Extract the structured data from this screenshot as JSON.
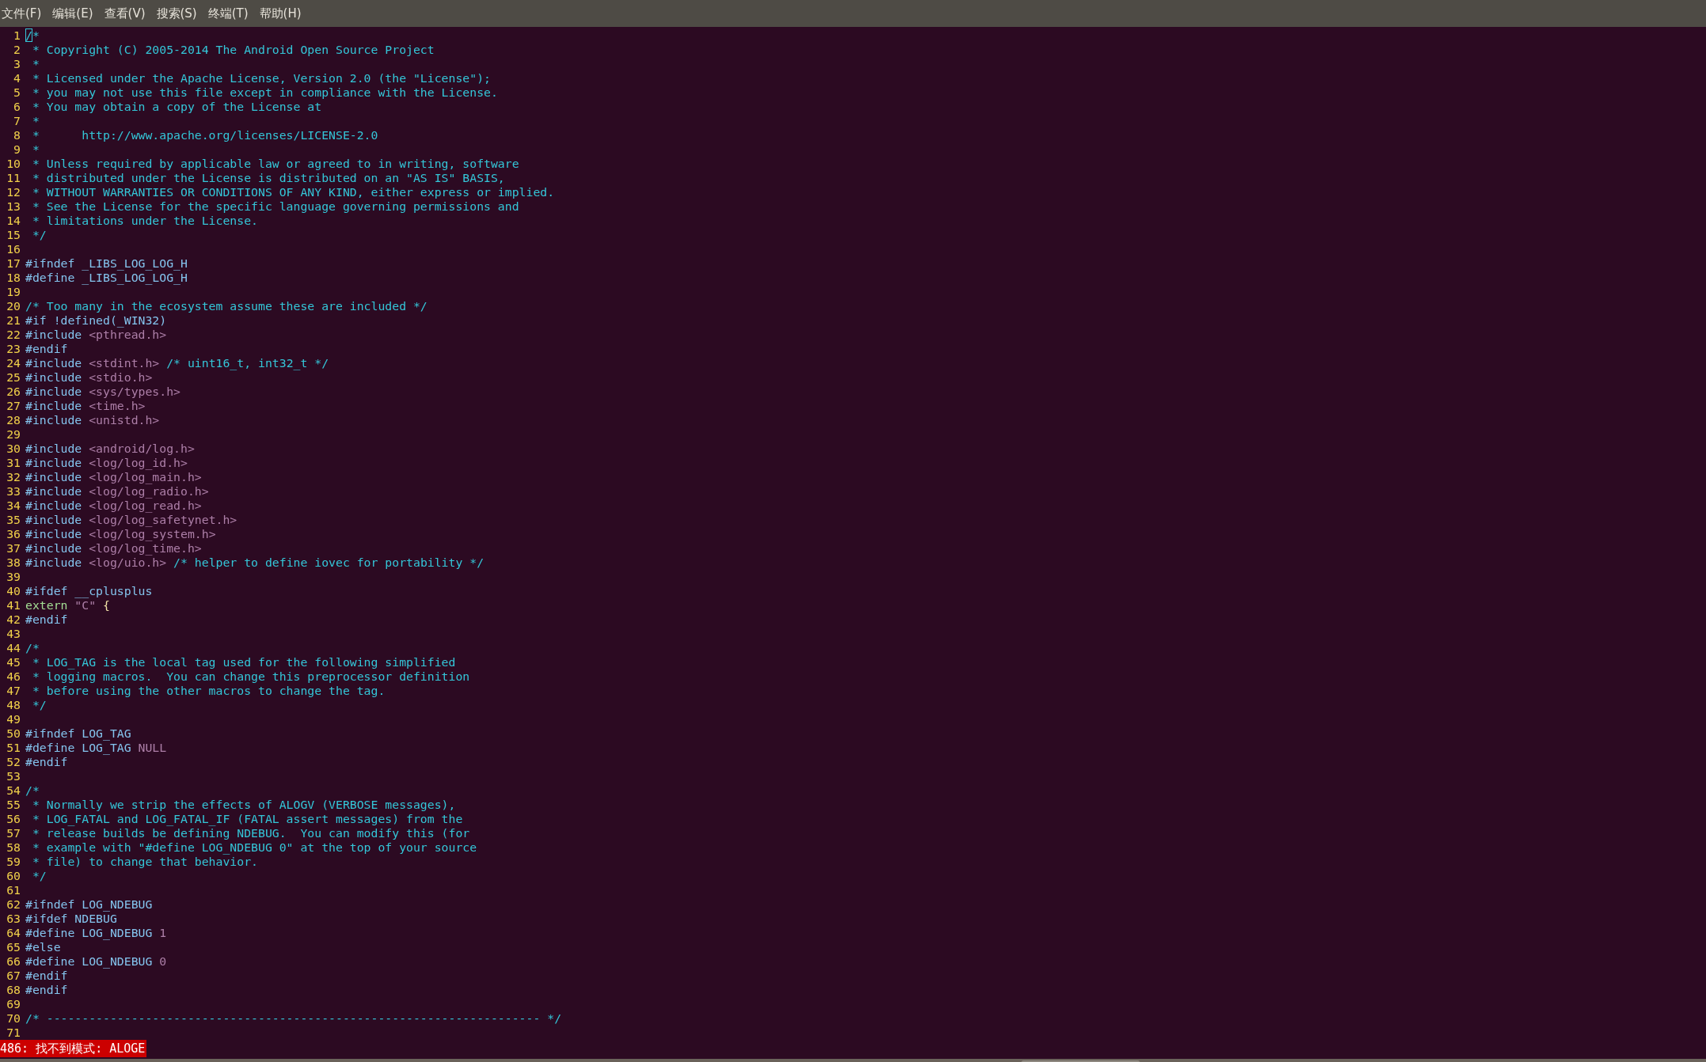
{
  "menu_bar": {
    "items": [
      {
        "label": "文件(F)"
      },
      {
        "label": "编辑(E)"
      },
      {
        "label": "查看(V)"
      },
      {
        "label": "搜索(S)"
      },
      {
        "label": "终端(T)"
      },
      {
        "label": "帮助(H)"
      }
    ]
  },
  "editor": {
    "lines": [
      {
        "number": "1",
        "segments": [
          {
            "kind": "cursor",
            "text": "/"
          },
          {
            "kind": "comment",
            "text": "*"
          }
        ]
      },
      {
        "number": "2",
        "segments": [
          {
            "kind": "comment",
            "text": " * Copyright (C) 2005-2014 The Android Open Source Project"
          }
        ]
      },
      {
        "number": "3",
        "segments": [
          {
            "kind": "comment",
            "text": " *"
          }
        ]
      },
      {
        "number": "4",
        "segments": [
          {
            "kind": "comment",
            "text": " * Licensed under the Apache License, Version 2.0 (the \"License\");"
          }
        ]
      },
      {
        "number": "5",
        "segments": [
          {
            "kind": "comment",
            "text": " * you may not use this file except in compliance with the License."
          }
        ]
      },
      {
        "number": "6",
        "segments": [
          {
            "kind": "comment",
            "text": " * You may obtain a copy of the License at"
          }
        ]
      },
      {
        "number": "7",
        "segments": [
          {
            "kind": "comment",
            "text": " *"
          }
        ]
      },
      {
        "number": "8",
        "segments": [
          {
            "kind": "comment",
            "text": " *      http://www.apache.org/licenses/LICENSE-2.0"
          }
        ]
      },
      {
        "number": "9",
        "segments": [
          {
            "kind": "comment",
            "text": " *"
          }
        ]
      },
      {
        "number": "10",
        "segments": [
          {
            "kind": "comment",
            "text": " * Unless required by applicable law or agreed to in writing, software"
          }
        ]
      },
      {
        "number": "11",
        "segments": [
          {
            "kind": "comment",
            "text": " * distributed under the License is distributed on an \"AS IS\" BASIS,"
          }
        ]
      },
      {
        "number": "12",
        "segments": [
          {
            "kind": "comment",
            "text": " * WITHOUT WARRANTIES OR CONDITIONS OF ANY KIND, either express or implied."
          }
        ]
      },
      {
        "number": "13",
        "segments": [
          {
            "kind": "comment",
            "text": " * See the License for the specific language governing permissions and"
          }
        ]
      },
      {
        "number": "14",
        "segments": [
          {
            "kind": "comment",
            "text": " * limitations under the License."
          }
        ]
      },
      {
        "number": "15",
        "segments": [
          {
            "kind": "comment",
            "text": " */"
          }
        ]
      },
      {
        "number": "16"
      },
      {
        "number": "17",
        "segments": [
          {
            "kind": "preproc",
            "text": "#ifndef _LIBS_LOG_LOG_H"
          }
        ]
      },
      {
        "number": "18",
        "segments": [
          {
            "kind": "preproc",
            "text": "#define _LIBS_LOG_LOG_H"
          }
        ]
      },
      {
        "number": "19"
      },
      {
        "number": "20",
        "segments": [
          {
            "kind": "comment",
            "text": "/* Too many in the ecosystem assume these are included */"
          }
        ]
      },
      {
        "number": "21",
        "segments": [
          {
            "kind": "preproc",
            "text": "#if !defined(_WIN32)"
          }
        ]
      },
      {
        "number": "22",
        "segments": [
          {
            "kind": "preproc",
            "text": "#include "
          },
          {
            "kind": "constant",
            "text": "<pthread.h>"
          }
        ]
      },
      {
        "number": "23",
        "segments": [
          {
            "kind": "preproc",
            "text": "#endif"
          }
        ]
      },
      {
        "number": "24",
        "segments": [
          {
            "kind": "preproc",
            "text": "#include "
          },
          {
            "kind": "constant",
            "text": "<stdint.h>"
          },
          {
            "kind": "comment",
            "text": " /* uint16_t, int32_t */"
          }
        ]
      },
      {
        "number": "25",
        "segments": [
          {
            "kind": "preproc",
            "text": "#include "
          },
          {
            "kind": "constant",
            "text": "<stdio.h>"
          }
        ]
      },
      {
        "number": "26",
        "segments": [
          {
            "kind": "preproc",
            "text": "#include "
          },
          {
            "kind": "constant",
            "text": "<sys/types.h>"
          }
        ]
      },
      {
        "number": "27",
        "segments": [
          {
            "kind": "preproc",
            "text": "#include "
          },
          {
            "kind": "constant",
            "text": "<time.h>"
          }
        ]
      },
      {
        "number": "28",
        "segments": [
          {
            "kind": "preproc",
            "text": "#include "
          },
          {
            "kind": "constant",
            "text": "<unistd.h>"
          }
        ]
      },
      {
        "number": "29"
      },
      {
        "number": "30",
        "segments": [
          {
            "kind": "preproc",
            "text": "#include "
          },
          {
            "kind": "constant",
            "text": "<android/log.h>"
          }
        ]
      },
      {
        "number": "31",
        "segments": [
          {
            "kind": "preproc",
            "text": "#include "
          },
          {
            "kind": "constant",
            "text": "<log/log_id.h>"
          }
        ]
      },
      {
        "number": "32",
        "segments": [
          {
            "kind": "preproc",
            "text": "#include "
          },
          {
            "kind": "constant",
            "text": "<log/log_main.h>"
          }
        ]
      },
      {
        "number": "33",
        "segments": [
          {
            "kind": "preproc",
            "text": "#include "
          },
          {
            "kind": "constant",
            "text": "<log/log_radio.h>"
          }
        ]
      },
      {
        "number": "34",
        "segments": [
          {
            "kind": "preproc",
            "text": "#include "
          },
          {
            "kind": "constant",
            "text": "<log/log_read.h>"
          }
        ]
      },
      {
        "number": "35",
        "segments": [
          {
            "kind": "preproc",
            "text": "#include "
          },
          {
            "kind": "constant",
            "text": "<log/log_safetynet.h>"
          }
        ]
      },
      {
        "number": "36",
        "segments": [
          {
            "kind": "preproc",
            "text": "#include "
          },
          {
            "kind": "constant",
            "text": "<log/log_system.h>"
          }
        ]
      },
      {
        "number": "37",
        "segments": [
          {
            "kind": "preproc",
            "text": "#include "
          },
          {
            "kind": "constant",
            "text": "<log/log_time.h>"
          }
        ]
      },
      {
        "number": "38",
        "segments": [
          {
            "kind": "preproc",
            "text": "#include "
          },
          {
            "kind": "constant",
            "text": "<log/uio.h>"
          },
          {
            "kind": "comment",
            "text": " /* helper to define iovec for portability */"
          }
        ]
      },
      {
        "number": "39"
      },
      {
        "number": "40",
        "segments": [
          {
            "kind": "preproc",
            "text": "#ifdef __cplusplus"
          }
        ]
      },
      {
        "number": "41",
        "segments": [
          {
            "kind": "keyword",
            "text": "extern "
          },
          {
            "kind": "constant",
            "text": "\"C\""
          },
          {
            "kind": "plain",
            "text": " {"
          }
        ]
      },
      {
        "number": "42",
        "segments": [
          {
            "kind": "preproc",
            "text": "#endif"
          }
        ]
      },
      {
        "number": "43"
      },
      {
        "number": "44",
        "segments": [
          {
            "kind": "comment",
            "text": "/*"
          }
        ]
      },
      {
        "number": "45",
        "segments": [
          {
            "kind": "comment",
            "text": " * LOG_TAG is the local tag used for the following simplified"
          }
        ]
      },
      {
        "number": "46",
        "segments": [
          {
            "kind": "comment",
            "text": " * logging macros.  You can change this preprocessor definition"
          }
        ]
      },
      {
        "number": "47",
        "segments": [
          {
            "kind": "comment",
            "text": " * before using the other macros to change the tag."
          }
        ]
      },
      {
        "number": "48",
        "segments": [
          {
            "kind": "comment",
            "text": " */"
          }
        ]
      },
      {
        "number": "49"
      },
      {
        "number": "50",
        "segments": [
          {
            "kind": "preproc",
            "text": "#ifndef LOG_TAG"
          }
        ]
      },
      {
        "number": "51",
        "segments": [
          {
            "kind": "preproc",
            "text": "#define LOG_TAG "
          },
          {
            "kind": "constant",
            "text": "NULL"
          }
        ]
      },
      {
        "number": "52",
        "segments": [
          {
            "kind": "preproc",
            "text": "#endif"
          }
        ]
      },
      {
        "number": "53"
      },
      {
        "number": "54",
        "segments": [
          {
            "kind": "comment",
            "text": "/*"
          }
        ]
      },
      {
        "number": "55",
        "segments": [
          {
            "kind": "comment",
            "text": " * Normally we strip the effects of ALOGV (VERBOSE messages),"
          }
        ]
      },
      {
        "number": "56",
        "segments": [
          {
            "kind": "comment",
            "text": " * LOG_FATAL and LOG_FATAL_IF (FATAL assert messages) from the"
          }
        ]
      },
      {
        "number": "57",
        "segments": [
          {
            "kind": "comment",
            "text": " * release builds be defining NDEBUG.  You can modify this (for"
          }
        ]
      },
      {
        "number": "58",
        "segments": [
          {
            "kind": "comment",
            "text": " * example with \"#define LOG_NDEBUG 0\" at the top of your source"
          }
        ]
      },
      {
        "number": "59",
        "segments": [
          {
            "kind": "comment",
            "text": " * file) to change that behavior."
          }
        ]
      },
      {
        "number": "60",
        "segments": [
          {
            "kind": "comment",
            "text": " */"
          }
        ]
      },
      {
        "number": "61"
      },
      {
        "number": "62",
        "segments": [
          {
            "kind": "preproc",
            "text": "#ifndef LOG_NDEBUG"
          }
        ]
      },
      {
        "number": "63",
        "segments": [
          {
            "kind": "preproc",
            "text": "#ifdef NDEBUG"
          }
        ]
      },
      {
        "number": "64",
        "segments": [
          {
            "kind": "preproc",
            "text": "#define LOG_NDEBUG "
          },
          {
            "kind": "constant",
            "text": "1"
          }
        ]
      },
      {
        "number": "65",
        "segments": [
          {
            "kind": "preproc",
            "text": "#else"
          }
        ]
      },
      {
        "number": "66",
        "segments": [
          {
            "kind": "preproc",
            "text": "#define LOG_NDEBUG "
          },
          {
            "kind": "constant",
            "text": "0"
          }
        ]
      },
      {
        "number": "67",
        "segments": [
          {
            "kind": "preproc",
            "text": "#endif"
          }
        ]
      },
      {
        "number": "68",
        "segments": [
          {
            "kind": "preproc",
            "text": "#endif"
          }
        ]
      },
      {
        "number": "69"
      },
      {
        "number": "70",
        "segments": [
          {
            "kind": "comment",
            "text": "/* ---------------------------------------------------------------------- */"
          }
        ]
      },
      {
        "number": "71"
      }
    ]
  },
  "message_line": {
    "kind": "error",
    "text": "486: 找不到模式: ALOGE"
  }
}
